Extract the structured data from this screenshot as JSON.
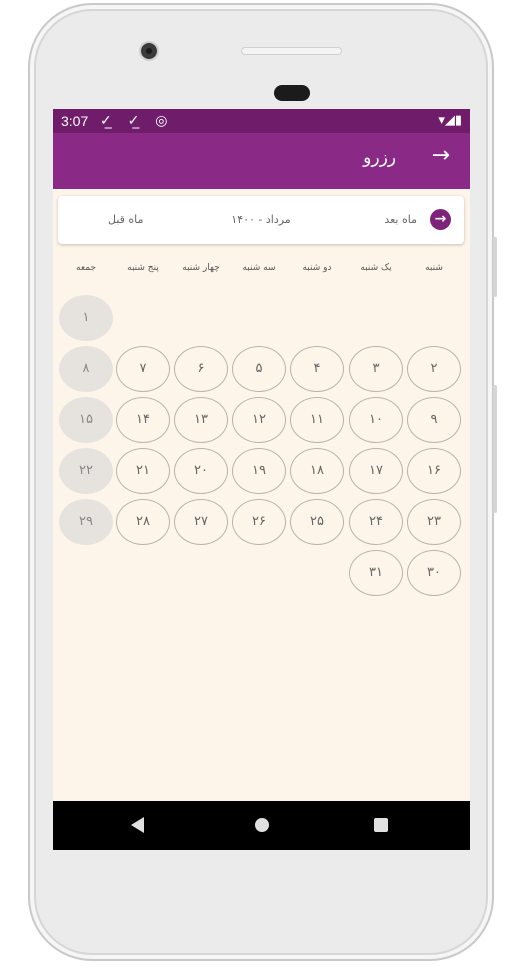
{
  "status_bar": {
    "time": "3:07",
    "left_icons": "✓̲ ✓̲ ◎",
    "right_icons": "▾◢▮"
  },
  "app_bar": {
    "title": "رزرو",
    "back_icon": "arrow-right-icon"
  },
  "month_nav": {
    "next_label": "ماه بعد",
    "current_month": "مرداد - ۱۴۰۰",
    "prev_label": "ماه قبل",
    "next_icon": "→"
  },
  "weekdays": [
    "شنبه",
    "یک شنبه",
    "دو شنبه",
    "سه شنبه",
    "چهار شنبه",
    "پنج شنبه",
    "جمعه"
  ],
  "weeks": [
    [
      "",
      "",
      "",
      "",
      "",
      "",
      "۱"
    ],
    [
      "۲",
      "۳",
      "۴",
      "۵",
      "۶",
      "۷",
      "۸"
    ],
    [
      "۹",
      "۱۰",
      "۱۱",
      "۱۲",
      "۱۳",
      "۱۴",
      "۱۵"
    ],
    [
      "۱۶",
      "۱۷",
      "۱۸",
      "۱۹",
      "۲۰",
      "۲۱",
      "۲۲"
    ],
    [
      "۲۳",
      "۲۴",
      "۲۵",
      "۲۶",
      "۲۷",
      "۲۸",
      "۲۹"
    ],
    [
      "۳۰",
      "۳۱",
      "",
      "",
      "",
      "",
      ""
    ]
  ],
  "colors": {
    "status_bar": "#6f1d6a",
    "app_bar": "#8a2a86",
    "background": "#fdf5e9",
    "friday_fill": "#e6e3df"
  }
}
